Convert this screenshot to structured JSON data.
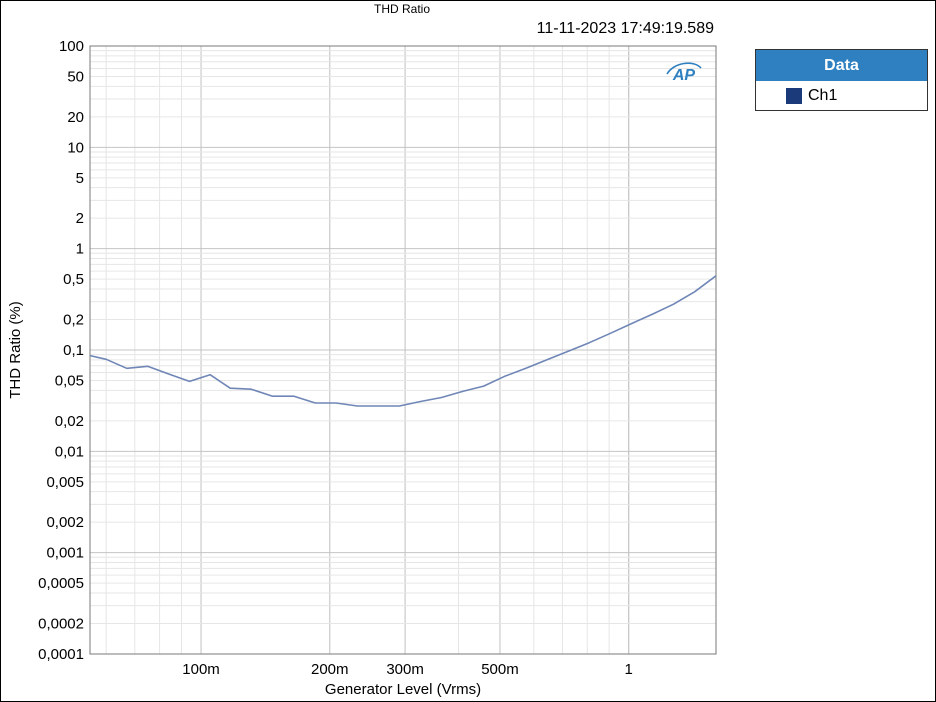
{
  "colors": {
    "series": "#6f86b6",
    "legend_header": "#2f80c0",
    "legend_swatch": "#1a3a7a",
    "grid_major": "#c4c4c4",
    "grid_minor": "#e6e6e6",
    "logo": "#2f80c0"
  },
  "header": {
    "timestamp": "11-11-2023 17:49:19.589"
  },
  "legend": {
    "title": "Data",
    "items": [
      {
        "label": "Ch1"
      }
    ]
  },
  "logo": {
    "text": "AP"
  },
  "chart_data": {
    "type": "line",
    "title": "THD Ratio",
    "xlabel": "Generator Level (Vrms)",
    "ylabel": "THD Ratio (%)",
    "x_scale": "log",
    "y_scale": "log",
    "xlim": [
      0.055,
      1.6
    ],
    "ylim": [
      0.0001,
      100
    ],
    "grid": true,
    "legend_position": "right",
    "x_ticks": [
      {
        "value": 0.1,
        "label": "100m"
      },
      {
        "value": 0.2,
        "label": "200m"
      },
      {
        "value": 0.3,
        "label": "300m"
      },
      {
        "value": 0.5,
        "label": "500m"
      },
      {
        "value": 1,
        "label": "1"
      }
    ],
    "y_ticks": [
      {
        "value": 100,
        "label": "100"
      },
      {
        "value": 50,
        "label": "50"
      },
      {
        "value": 20,
        "label": "20"
      },
      {
        "value": 10,
        "label": "10"
      },
      {
        "value": 5,
        "label": "5"
      },
      {
        "value": 2,
        "label": "2"
      },
      {
        "value": 1,
        "label": "1"
      },
      {
        "value": 0.5,
        "label": "0,5"
      },
      {
        "value": 0.2,
        "label": "0,2"
      },
      {
        "value": 0.1,
        "label": "0,1"
      },
      {
        "value": 0.05,
        "label": "0,05"
      },
      {
        "value": 0.02,
        "label": "0,02"
      },
      {
        "value": 0.01,
        "label": "0,01"
      },
      {
        "value": 0.005,
        "label": "0,005"
      },
      {
        "value": 0.002,
        "label": "0,002"
      },
      {
        "value": 0.001,
        "label": "0,001"
      },
      {
        "value": 0.0005,
        "label": "0,0005"
      },
      {
        "value": 0.0002,
        "label": "0,0002"
      },
      {
        "value": 0.0001,
        "label": "0,0001"
      }
    ],
    "series": [
      {
        "name": "Ch1",
        "points": [
          [
            0.055,
            0.088
          ],
          [
            0.06,
            0.081
          ],
          [
            0.067,
            0.066
          ],
          [
            0.075,
            0.069
          ],
          [
            0.084,
            0.058
          ],
          [
            0.094,
            0.049
          ],
          [
            0.105,
            0.057
          ],
          [
            0.117,
            0.042
          ],
          [
            0.131,
            0.041
          ],
          [
            0.147,
            0.035
          ],
          [
            0.165,
            0.035
          ],
          [
            0.185,
            0.03
          ],
          [
            0.207,
            0.03
          ],
          [
            0.232,
            0.028
          ],
          [
            0.26,
            0.028
          ],
          [
            0.291,
            0.028
          ],
          [
            0.326,
            0.031
          ],
          [
            0.365,
            0.034
          ],
          [
            0.409,
            0.039
          ],
          [
            0.458,
            0.044
          ],
          [
            0.513,
            0.055
          ],
          [
            0.575,
            0.066
          ],
          [
            0.644,
            0.08
          ],
          [
            0.722,
            0.097
          ],
          [
            0.809,
            0.118
          ],
          [
            0.906,
            0.146
          ],
          [
            1.015,
            0.182
          ],
          [
            1.137,
            0.226
          ],
          [
            1.273,
            0.283
          ],
          [
            1.426,
            0.375
          ],
          [
            1.6,
            0.54
          ]
        ]
      }
    ]
  }
}
